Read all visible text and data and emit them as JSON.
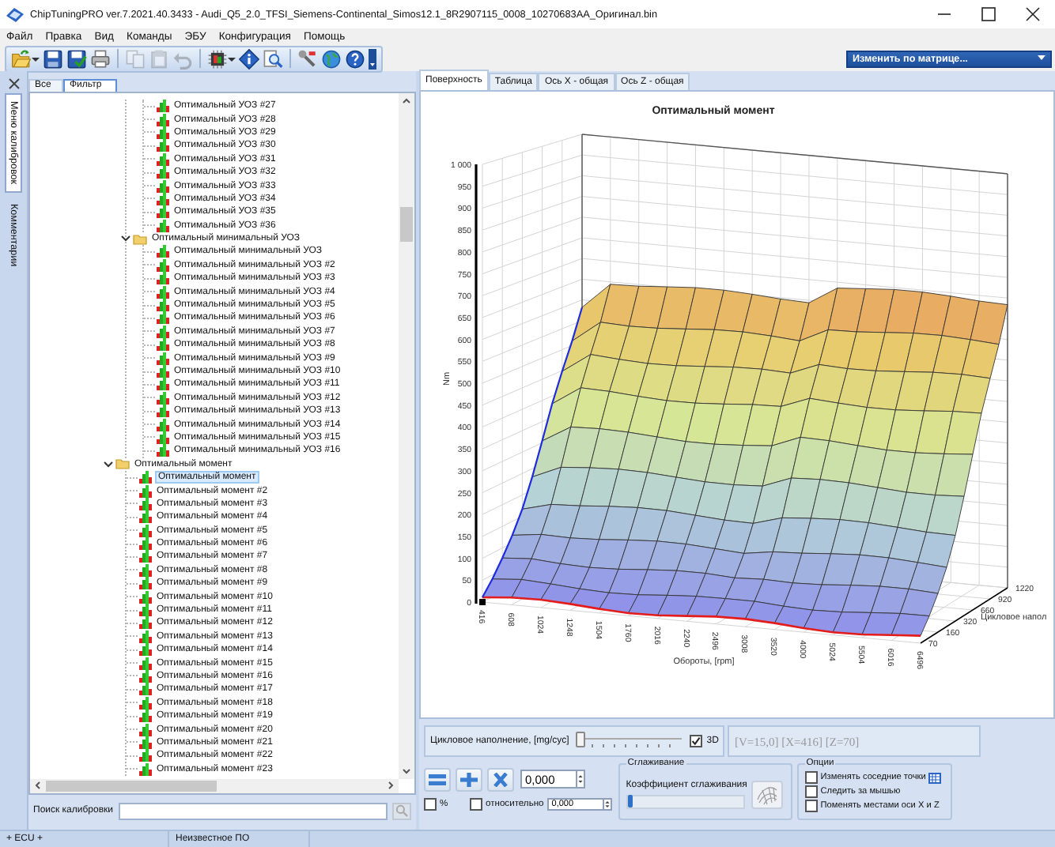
{
  "window": {
    "title": "ChipTuningPRO ver.7.2021.40.3433 - Audi_Q5_2.0_TFSI_Siemens-Continental_Simos12.1_8R2907115_0008_10270683AA_Оригинал.bin"
  },
  "menu": [
    "Файл",
    "Правка",
    "Вид",
    "Команды",
    "ЭБУ",
    "Конфигурация",
    "Помощь"
  ],
  "toolbar": {
    "buttons": [
      {
        "kind": "open",
        "disabled": false,
        "dropdown": true
      },
      {
        "kind": "save",
        "disabled": false
      },
      {
        "kind": "save_as",
        "disabled": false
      },
      {
        "kind": "print",
        "disabled": false
      },
      {
        "kind": "separator"
      },
      {
        "kind": "copy",
        "disabled": true
      },
      {
        "kind": "paste",
        "disabled": true
      },
      {
        "kind": "undo",
        "disabled": true
      },
      {
        "kind": "separator"
      },
      {
        "kind": "chip",
        "disabled": false,
        "dropdown": true
      },
      {
        "kind": "info",
        "disabled": false
      },
      {
        "kind": "find",
        "disabled": false
      },
      {
        "kind": "separator"
      },
      {
        "kind": "tool",
        "disabled": false
      },
      {
        "kind": "web",
        "disabled": false
      },
      {
        "kind": "help",
        "disabled": false
      }
    ],
    "matrix_dropdown": "Изменить по матрице..."
  },
  "side_tabs": [
    {
      "label": "Меню калибровок",
      "selected": true
    },
    {
      "label": "Комментарии",
      "selected": false
    }
  ],
  "filter_tabs": [
    {
      "label": "Все",
      "selected": false
    },
    {
      "label": "Фильтр",
      "selected": true
    }
  ],
  "tree": [
    {
      "kind": "continued",
      "children": [
        {
          "kind": "continued",
          "children": [
            {
              "kind": "map",
              "label": "Оптимальный УОЗ #27",
              "selected": false
            },
            {
              "kind": "map",
              "label": "Оптимальный УОЗ #28",
              "selected": false
            },
            {
              "kind": "map",
              "label": "Оптимальный УОЗ #29",
              "selected": false
            },
            {
              "kind": "map",
              "label": "Оптимальный УОЗ #30",
              "selected": false
            },
            {
              "kind": "map",
              "label": "Оптимальный УОЗ #31",
              "selected": false
            },
            {
              "kind": "map",
              "label": "Оптимальный УОЗ #32",
              "selected": false
            },
            {
              "kind": "map",
              "label": "Оптимальный УОЗ #33",
              "selected": false
            },
            {
              "kind": "map",
              "label": "Оптимальный УОЗ #34",
              "selected": false
            },
            {
              "kind": "map",
              "label": "Оптимальный УОЗ #35",
              "selected": false
            },
            {
              "kind": "map",
              "label": "Оптимальный УОЗ #36",
              "selected": false
            }
          ]
        },
        {
          "kind": "folder",
          "label": "Оптимальный минимальный УОЗ",
          "expanded": true,
          "selected": false,
          "children": [
            {
              "kind": "map",
              "label": "Оптимальный минимальный УОЗ",
              "selected": false
            },
            {
              "kind": "map",
              "label": "Оптимальный минимальный УОЗ #2",
              "selected": false
            },
            {
              "kind": "map",
              "label": "Оптимальный минимальный УОЗ #3",
              "selected": false
            },
            {
              "kind": "map",
              "label": "Оптимальный минимальный УОЗ #4",
              "selected": false
            },
            {
              "kind": "map",
              "label": "Оптимальный минимальный УОЗ #5",
              "selected": false
            },
            {
              "kind": "map",
              "label": "Оптимальный минимальный УОЗ #6",
              "selected": false
            },
            {
              "kind": "map",
              "label": "Оптимальный минимальный УОЗ #7",
              "selected": false
            },
            {
              "kind": "map",
              "label": "Оптимальный минимальный УОЗ #8",
              "selected": false
            },
            {
              "kind": "map",
              "label": "Оптимальный минимальный УОЗ #9",
              "selected": false
            },
            {
              "kind": "map",
              "label": "Оптимальный минимальный УОЗ #10",
              "selected": false
            },
            {
              "kind": "map",
              "label": "Оптимальный минимальный УОЗ #11",
              "selected": false
            },
            {
              "kind": "map",
              "label": "Оптимальный минимальный УОЗ #12",
              "selected": false
            },
            {
              "kind": "map",
              "label": "Оптимальный минимальный УОЗ #13",
              "selected": false
            },
            {
              "kind": "map",
              "label": "Оптимальный минимальный УОЗ #14",
              "selected": false
            },
            {
              "kind": "map",
              "label": "Оптимальный минимальный УОЗ #15",
              "selected": false
            },
            {
              "kind": "map",
              "label": "Оптимальный минимальный УОЗ #16",
              "selected": false
            }
          ]
        }
      ]
    },
    {
      "kind": "folder",
      "label": "Оптимальный момент",
      "expanded": true,
      "selected": false,
      "children": [
        {
          "kind": "map",
          "label": "Оптимальный момент",
          "selected": true
        },
        {
          "kind": "map",
          "label": "Оптимальный момент #2",
          "selected": false
        },
        {
          "kind": "map",
          "label": "Оптимальный момент #3",
          "selected": false
        },
        {
          "kind": "map",
          "label": "Оптимальный момент #4",
          "selected": false
        },
        {
          "kind": "map",
          "label": "Оптимальный момент #5",
          "selected": false
        },
        {
          "kind": "map",
          "label": "Оптимальный момент #6",
          "selected": false
        },
        {
          "kind": "map",
          "label": "Оптимальный момент #7",
          "selected": false
        },
        {
          "kind": "map",
          "label": "Оптимальный момент #8",
          "selected": false
        },
        {
          "kind": "map",
          "label": "Оптимальный момент #9",
          "selected": false
        },
        {
          "kind": "map",
          "label": "Оптимальный момент #10",
          "selected": false
        },
        {
          "kind": "map",
          "label": "Оптимальный момент #11",
          "selected": false
        },
        {
          "kind": "map",
          "label": "Оптимальный момент #12",
          "selected": false
        },
        {
          "kind": "map",
          "label": "Оптимальный момент #13",
          "selected": false
        },
        {
          "kind": "map",
          "label": "Оптимальный момент #14",
          "selected": false
        },
        {
          "kind": "map",
          "label": "Оптимальный момент #15",
          "selected": false
        },
        {
          "kind": "map",
          "label": "Оптимальный момент #16",
          "selected": false
        },
        {
          "kind": "map",
          "label": "Оптимальный момент #17",
          "selected": false
        },
        {
          "kind": "map",
          "label": "Оптимальный момент #18",
          "selected": false
        },
        {
          "kind": "map",
          "label": "Оптимальный момент #19",
          "selected": false
        },
        {
          "kind": "map",
          "label": "Оптимальный момент #20",
          "selected": false
        },
        {
          "kind": "map",
          "label": "Оптимальный момент #21",
          "selected": false
        },
        {
          "kind": "map",
          "label": "Оптимальный момент #22",
          "selected": false
        },
        {
          "kind": "map",
          "label": "Оптимальный момент #23",
          "selected": false
        }
      ]
    }
  ],
  "search": {
    "label": "Поиск калибровки"
  },
  "view_tabs": [
    {
      "label": "Поверхность",
      "selected": true
    },
    {
      "label": "Таблица",
      "selected": false
    },
    {
      "label": "Ось X - общая",
      "selected": false
    },
    {
      "label": "Ось Z - общая",
      "selected": false
    }
  ],
  "surface": {
    "title": "Оптимальный момент",
    "y_label": "Nm",
    "x_label": "Обороты, [rpm]",
    "z_label": "Цикловое напол",
    "y_ticks": [
      "1 000",
      "950",
      "900",
      "850",
      "800",
      "750",
      "700",
      "650",
      "600",
      "550",
      "500",
      "450",
      "400",
      "350",
      "300",
      "250",
      "200",
      "150",
      "100",
      "50",
      "0"
    ],
    "x_ticks": [
      "416",
      "608",
      "1024",
      "1248",
      "1504",
      "1760",
      "2016",
      "2240",
      "2496",
      "3008",
      "3520",
      "4000",
      "5024",
      "5504",
      "6016",
      "6496"
    ],
    "z_ticks": [
      "70",
      "160",
      "320",
      "660",
      "920",
      "1220"
    ]
  },
  "slice": {
    "label": "Цикловое наполнение, [mg/cyc]",
    "level": 0,
    "three_d": {
      "label": "3D",
      "checked": true
    }
  },
  "cursor_readout": "[V=15,0] [X=416] [Z=70]",
  "edit": {
    "buttons": [
      {
        "kind": "set"
      },
      {
        "kind": "add"
      },
      {
        "kind": "multiply"
      }
    ],
    "value": "0,000",
    "percent": {
      "label": "%",
      "checked": false
    },
    "relative": {
      "label": "относительно",
      "checked": false,
      "value": "0,000"
    }
  },
  "smoothing": {
    "title": "Сглаживание",
    "label": "Коэффициент сглаживания",
    "level": 0
  },
  "options": {
    "title": "Опции",
    "items": [
      {
        "kind": "grid",
        "label": "Изменять соседние точки",
        "checked": false
      },
      {
        "kind": "plain",
        "label": "Следить за мышью",
        "checked": false
      },
      {
        "kind": "plain",
        "label": "Поменять местами оси X и Z",
        "checked": false
      }
    ]
  },
  "status_bar": [
    "+ ECU +",
    "Неизвестное ПО"
  ]
}
